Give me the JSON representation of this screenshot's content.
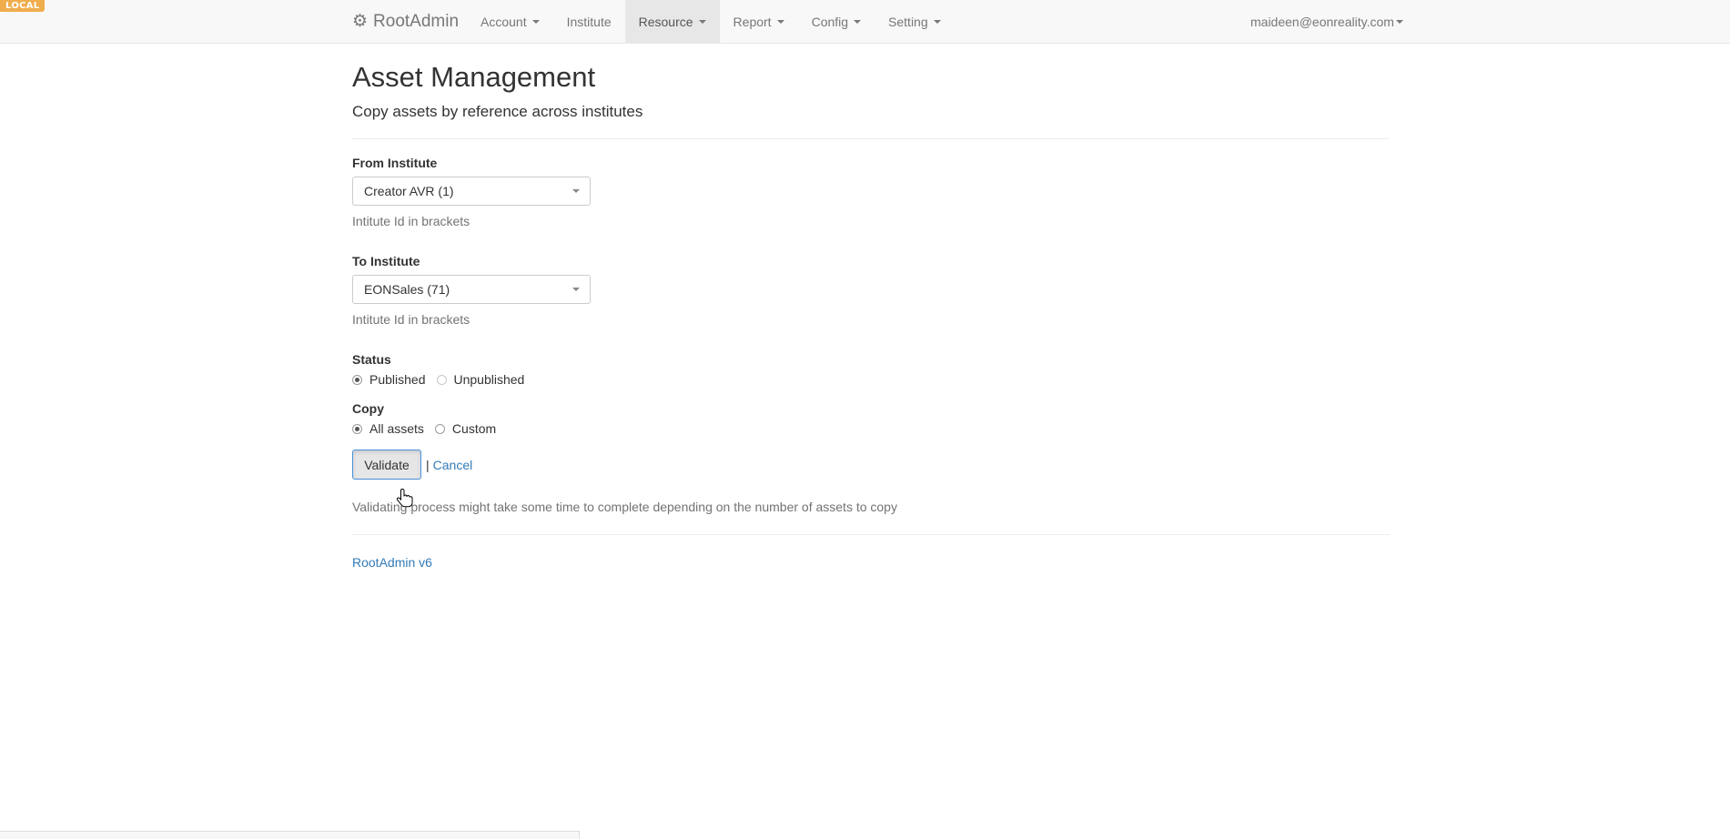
{
  "env_badge": "LOCAL",
  "navbar": {
    "brand": "RootAdmin",
    "items": [
      {
        "label": "Account",
        "dropdown": true,
        "active": false
      },
      {
        "label": "Institute",
        "dropdown": false,
        "active": false
      },
      {
        "label": "Resource",
        "dropdown": true,
        "active": true
      },
      {
        "label": "Report",
        "dropdown": true,
        "active": false
      },
      {
        "label": "Config",
        "dropdown": true,
        "active": false
      },
      {
        "label": "Setting",
        "dropdown": true,
        "active": false
      }
    ],
    "user": "maideen@eonreality.com"
  },
  "page": {
    "title": "Asset Management",
    "subtitle": "Copy assets by reference across institutes"
  },
  "form": {
    "from_institute": {
      "label": "From Institute",
      "value": "Creator AVR (1)",
      "help": "Intitute Id in brackets"
    },
    "to_institute": {
      "label": "To Institute",
      "value": "EONSales (71)",
      "help": "Intitute Id in brackets"
    },
    "status": {
      "label": "Status",
      "options": [
        "Published",
        "Unpublished"
      ],
      "selected": "Published"
    },
    "copy": {
      "label": "Copy",
      "options": [
        "All assets",
        "Custom"
      ],
      "selected": "All assets"
    },
    "validate_label": "Validate",
    "separator": "|",
    "cancel_label": "Cancel",
    "note": "Validating process might take some time to complete depending on the number of assets to copy"
  },
  "footer": {
    "version_link": "RootAdmin v6"
  },
  "colors": {
    "link": "#337ab7",
    "navbar_bg": "#f8f8f8",
    "nav_active_bg": "#e7e7e7",
    "badge": "#f0ad4e"
  }
}
